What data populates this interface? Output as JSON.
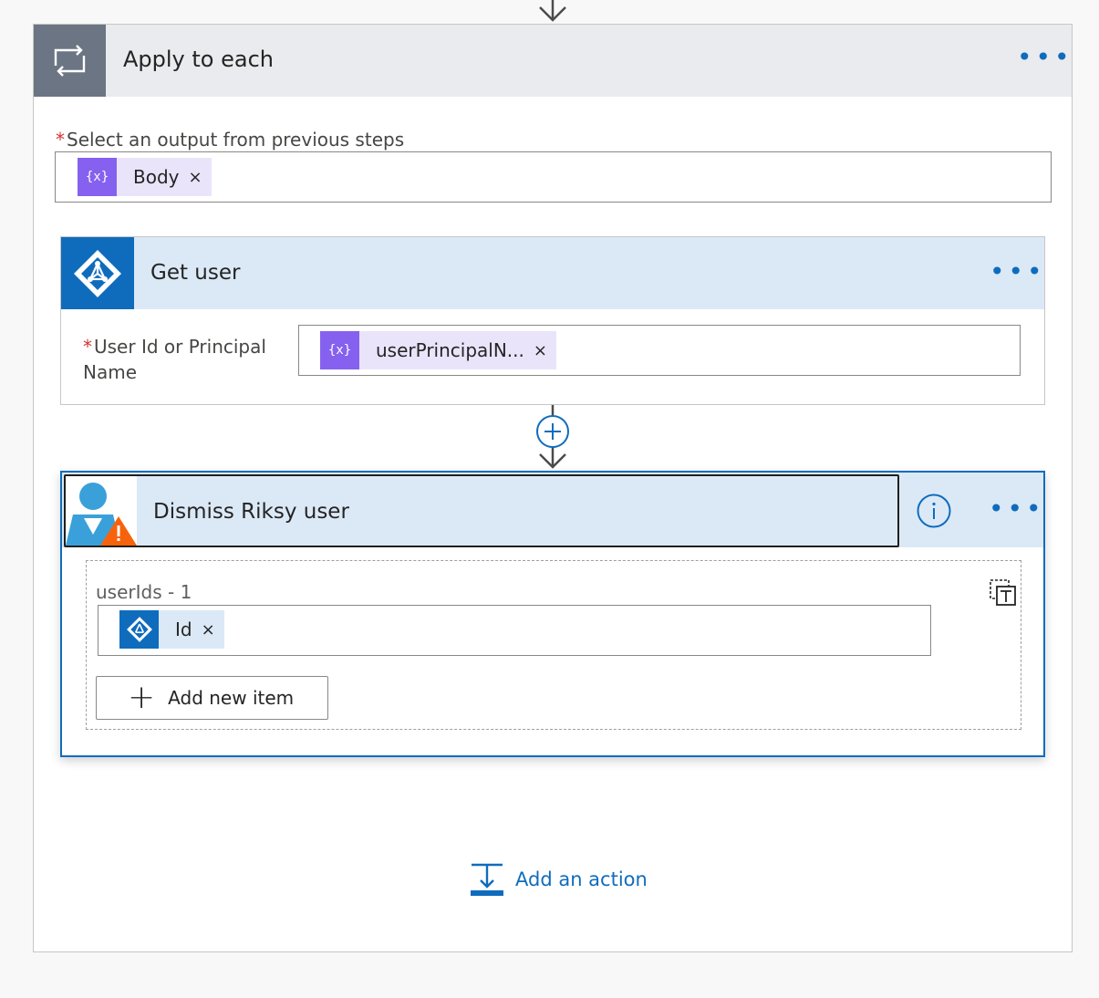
{
  "apply": {
    "title": "Apply to each",
    "more": "•••",
    "select_label": "Select an output from previous steps",
    "required_mark": "*",
    "token_icon": "{x}",
    "token_label": "Body",
    "token_close": "×"
  },
  "get_user": {
    "title": "Get user",
    "more": "•••",
    "field_label": "User Id or Principal Name",
    "required_mark": "*",
    "token_icon": "{x}",
    "token_label": "userPrincipalN...",
    "token_close": "×"
  },
  "dismiss": {
    "title": "Dismiss Riksy user",
    "more": "•••",
    "array_label": "userIds - 1",
    "token_label": "Id",
    "token_close": "×",
    "add_item_label": "Add new item"
  },
  "footer": {
    "add_action_label": "Add an action"
  },
  "icons": {
    "loop": "loop-icon",
    "azure_ad": "azure-ad-icon",
    "expression": "expression-icon",
    "risky_user": "risky-user-icon",
    "info": "info-icon",
    "delete": "delete-icon",
    "plus": "plus-icon",
    "add_action": "add-action-icon"
  },
  "colors": {
    "accent": "#0f6cbd",
    "token_purple": "#8661f0",
    "token_purple_bg": "#eae4fb",
    "header_gray": "#6b7583",
    "header_blue_bg": "#dbe9f7",
    "warning": "#f7630c",
    "required": "#d13438"
  }
}
